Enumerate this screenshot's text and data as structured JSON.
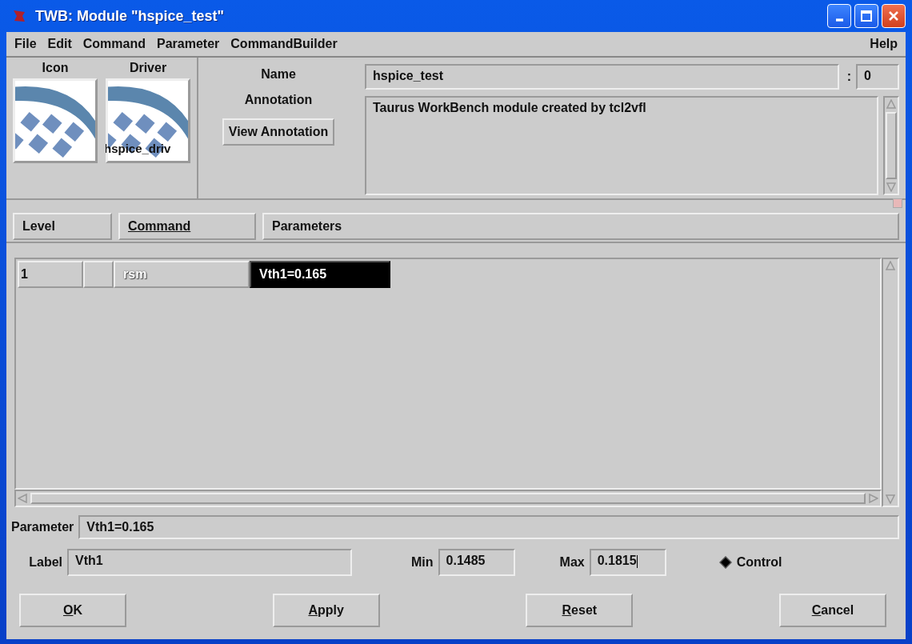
{
  "window": {
    "title": "TWB: Module \"hspice_test\""
  },
  "menu": {
    "left": [
      "File",
      "Edit",
      "Command",
      "Parameter",
      "CommandBuilder"
    ],
    "right": [
      "Help"
    ]
  },
  "module": {
    "icon_label": "Icon",
    "driver_label": "Driver",
    "driver_name": "hspice_driv",
    "name_label": "Name",
    "name": "hspice_test",
    "separator": ":",
    "version": "0",
    "annotation_label": "Annotation",
    "annotation": "Taurus WorkBench module created by tcl2vfl",
    "view_button": "View Annotation"
  },
  "table": {
    "columns": [
      {
        "label": "Level",
        "underlined": false
      },
      {
        "label": "Command",
        "underlined": true
      },
      {
        "label": "Parameters",
        "underlined": false
      }
    ],
    "rows": [
      {
        "level": "1",
        "command": "rsm",
        "command_disabled": true,
        "parameters": "Vth1=0.165",
        "parameters_selected": true
      }
    ]
  },
  "parameter": {
    "label": "Parameter",
    "value": "Vth1=0.165"
  },
  "fields": {
    "label_label": "Label",
    "label_value": "Vth1",
    "min_label": "Min",
    "min_value": "0.1485",
    "max_label": "Max",
    "max_value": "0.1815",
    "control_label": "Control",
    "control_selected": true
  },
  "buttons": [
    {
      "label": "OK",
      "underline_first": true
    },
    {
      "label": "Apply",
      "underline_first": true
    },
    {
      "label": "Reset",
      "underline_first": true
    },
    {
      "label": "Cancel",
      "underline_first": true
    }
  ]
}
